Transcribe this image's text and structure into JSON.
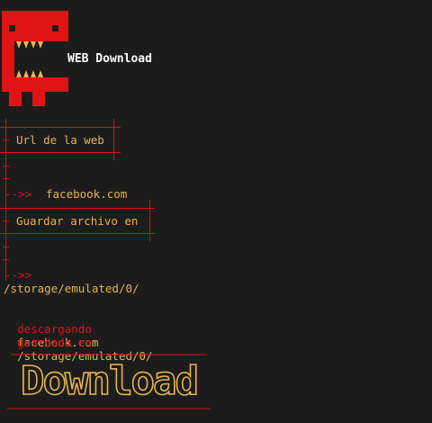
{
  "app": {
    "title": "WEB Download"
  },
  "prompts": {
    "url_label": "Url de la web",
    "url_arrow": "-->>",
    "url_value": "facebook.com",
    "save_label": "Guardar archivo en",
    "save_arrow": "-->>",
    "save_value": "/storage/emulated/0/"
  },
  "status": {
    "downloading_word": "descargando",
    "downloading_value": "facebook.com",
    "saved_word": "guardado en",
    "saved_value": "/storage/emulated/0/"
  },
  "banner": {
    "text": "Download"
  },
  "colors": {
    "background": "#1c1c1c",
    "accent_red": "#e01414",
    "gold": "#e6b450",
    "white": "#ffffff"
  },
  "icons": {
    "logo": "red-monster-logo-icon"
  }
}
